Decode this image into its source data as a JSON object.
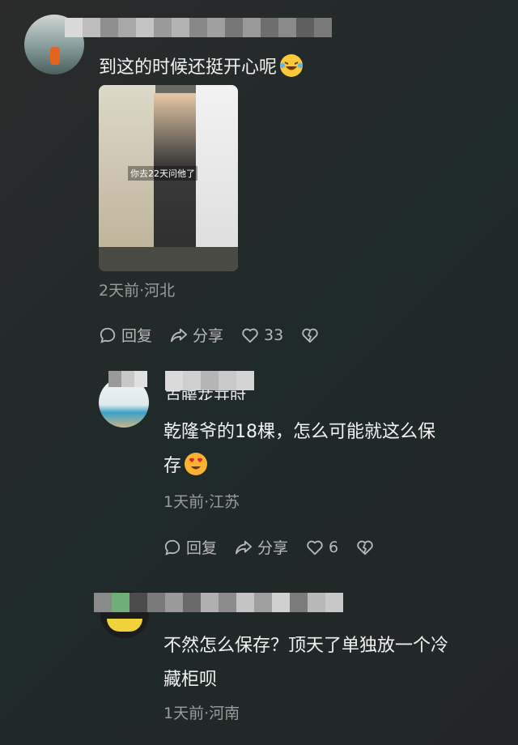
{
  "comments": [
    {
      "text": "到这的时候还挺开心呢",
      "emoji": "laughing-tears",
      "image_caption": "你去22天问他了",
      "meta": "2天前·河北",
      "reply_label": "回复",
      "share_label": "分享",
      "likes": "33"
    },
    {
      "username_partial": "百暖花开时",
      "text_line1": "乾隆爷的18棵，怎么可能就这么保",
      "text_line2": "存",
      "emoji": "heart-eyes",
      "meta": "1天前·江苏",
      "reply_label": "回复",
      "share_label": "分享",
      "likes": "6"
    },
    {
      "text_line1": "不然怎么保存？顶天了单独放一个冷",
      "text_line2": "藏柜呗",
      "meta": "1天前·河南"
    }
  ]
}
